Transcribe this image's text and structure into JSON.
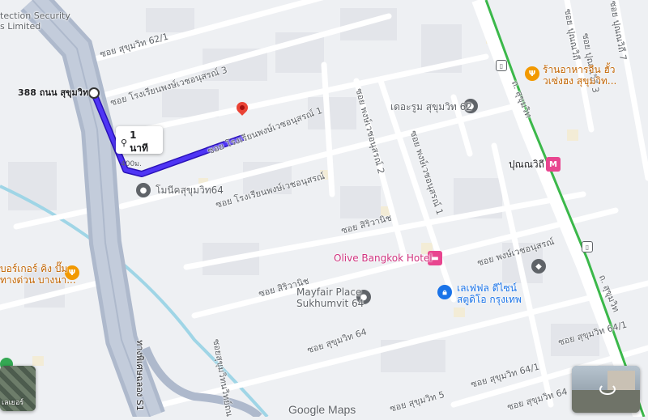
{
  "map": {
    "labels": {
      "company": "tection Security\ns Limited",
      "start_address": "388 ถนน สุขุมวิท",
      "soi_62_1": "ซอย สุขุมวิท 62/1",
      "soi_rongrian_3": "ซอย โรงเรียนพงษ์เวชอนุสรณ์ 3",
      "soi_rongrian_1": "ซอย โรงเรียนพงษ์เวชอนุสรณ์ 1",
      "soi_rongrian": "ซอย โรงเรียนพงษ์เวชอนุสรณ์",
      "soi_pongwet_2": "ซอย พงษ์เวชอนุสรณ์ 2",
      "soi_pongwet_1": "ซอย พงษ์เวชอนุสรณ์ 1",
      "soi_pongwet": "ซอย พงษ์เวชอนุสรณ์",
      "soi_siriwanit_1": "ซอย สิริวานิช",
      "soi_siriwanit_2": "ซอย สิริวานิช",
      "soi_sukhumvit_64": "ซอย สุขุมวิท 64",
      "soi_sukhumvit_64_1_a": "ซอย สุขุมวิท 64/1",
      "soi_sukhumvit_64_1_b": "ซอย สุขุมวิท 64/1",
      "soi_sukhumvit_64_bottom": "ซอย สุขุมวิท 64",
      "soi_punnawithi": "ซอย ปุณณวิถี",
      "soi_punnawithi_3": "ซอย ปุณณวิถี 3",
      "soi_punnawithi_7": "ซอย ปุณณวิถี 7",
      "soi_5": "ซอย สุขุมวิท 5",
      "thanon_sukhumvit_top": "ถ. สุขุมวิท",
      "thanon_sukhumvit_bottom": "ถ. สุขุมวิท",
      "expressway": "ทางพิเศษฉลอง S1",
      "bottom_road": "ซอยสุขุมวิทนวิทย์ถน"
    },
    "pois": {
      "the_room": "เดอะรูม สุขุมวิท 62",
      "monix": "โมนีคสุขุมวิท64",
      "restaurant": "ร้านอาหารจีน ฮั้ว\nวเซ่งฮง สุขุมวิท...",
      "punnawithi": "ปุณณวิถี",
      "olive": "Olive Bangkok Hotel",
      "mayfair": "Mayfair Place\nSukhumvit 64",
      "le_fell": "เลเฟฟล ดีไซน์\nสตูดิโอ กรุงเทพ",
      "burger": "บอร์เกอร์ คิง ปั๊ม\nทางด่วน บางนา..."
    },
    "route": {
      "duration": "1 นาที",
      "distance": "400ม."
    },
    "attribution": "Google Maps",
    "layers_label": "เลเยอร์",
    "colors": {
      "route": "#3b1ee6",
      "expressway": "#aeb9cc",
      "road": "#ffffff",
      "canal": "#9fd5e6",
      "rail": "#3bb84a",
      "pin_red": "#ea4335",
      "hotel_pink": "#e8458f",
      "food_orange": "#f29900",
      "blue_poi": "#1a73e8"
    }
  }
}
